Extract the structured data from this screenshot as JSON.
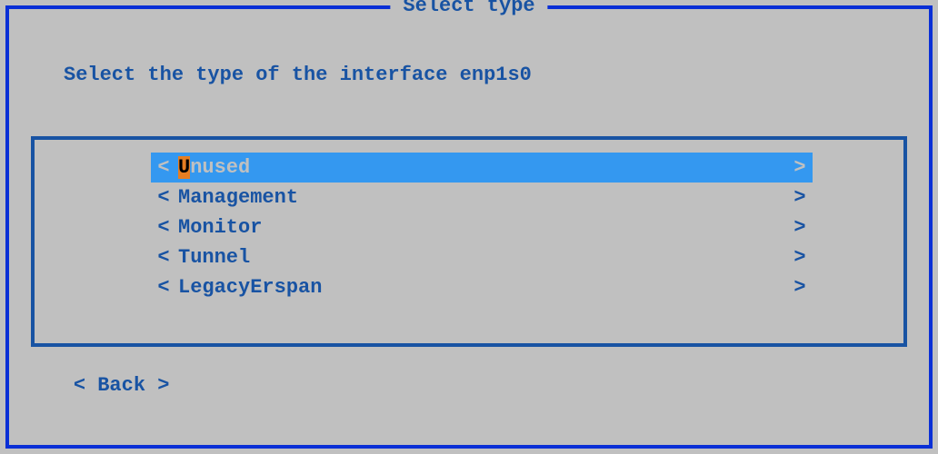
{
  "title": "Select type",
  "prompt": "Select the type of the interface enp1s0",
  "options": [
    {
      "label": "Unused",
      "selected": true
    },
    {
      "label": "Management",
      "selected": false
    },
    {
      "label": "Monitor",
      "selected": false
    },
    {
      "label": "Tunnel",
      "selected": false
    },
    {
      "label": "LegacyErspan",
      "selected": false
    }
  ],
  "back_label": "Back"
}
